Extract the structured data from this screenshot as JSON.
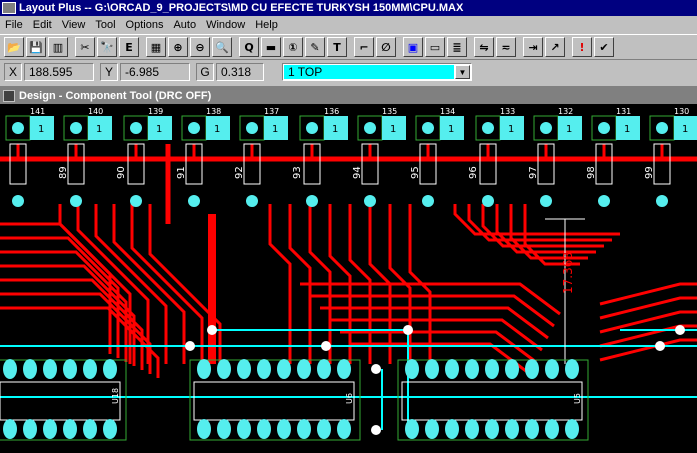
{
  "window": {
    "title": "Layout Plus -- G:\\ORCAD_9_PROJECTS\\MD CU EFECTE TURKYSH 150MM\\CPU.MAX"
  },
  "menu": [
    "File",
    "Edit",
    "View",
    "Tool",
    "Options",
    "Auto",
    "Window",
    "Help"
  ],
  "toolbar": {
    "buttons": [
      {
        "name": "open-icon",
        "glyph": "📂"
      },
      {
        "name": "save-icon",
        "glyph": "💾"
      },
      {
        "name": "report-icon",
        "glyph": "▥"
      },
      {
        "name": "cut-icon",
        "glyph": "✂"
      },
      {
        "name": "find-icon",
        "glyph": "🔭"
      },
      {
        "name": "spreadsheet-icon",
        "glyph": "E"
      },
      {
        "name": "grid-icon",
        "glyph": "▦"
      },
      {
        "name": "zoom-in-icon",
        "glyph": "⊕"
      },
      {
        "name": "zoom-out-icon",
        "glyph": "⊖"
      },
      {
        "name": "zoom-all-icon",
        "glyph": "🔍"
      },
      {
        "name": "query-icon",
        "glyph": "Q"
      },
      {
        "name": "component-icon",
        "glyph": "▬"
      },
      {
        "name": "pin-icon",
        "glyph": "①"
      },
      {
        "name": "edit-obstacle-icon",
        "glyph": "✎"
      },
      {
        "name": "text-icon",
        "glyph": "T"
      },
      {
        "name": "connection-icon",
        "glyph": "⌐"
      },
      {
        "name": "error-icon",
        "glyph": "∅"
      },
      {
        "name": "color-icon",
        "glyph": "▣"
      },
      {
        "name": "drc-box-icon",
        "glyph": "▭"
      },
      {
        "name": "layer-icon",
        "glyph": "≣"
      },
      {
        "name": "route-icon",
        "glyph": "⇋"
      },
      {
        "name": "shove-icon",
        "glyph": "≂"
      },
      {
        "name": "reconnect-icon",
        "glyph": "⇥"
      },
      {
        "name": "auto-path-icon",
        "glyph": "↗"
      },
      {
        "name": "online-drc-icon",
        "glyph": "!"
      },
      {
        "name": "drc-check-icon",
        "glyph": "✔"
      }
    ]
  },
  "coords": {
    "x_label": "X",
    "x_value": "188.595",
    "y_label": "Y",
    "y_value": "-6.985",
    "g_label": "G",
    "g_value": "0.318"
  },
  "layer": {
    "selected": "1 TOP"
  },
  "child_window": {
    "title": "Design - Component Tool (DRC OFF)"
  },
  "board": {
    "top_labels": [
      "141",
      "140",
      "139",
      "138",
      "137",
      "136",
      "135",
      "134",
      "133",
      "132",
      "131",
      "130"
    ],
    "pad_one_label": "1",
    "net_numbers": [
      "89",
      "90",
      "91",
      "92",
      "93",
      "94",
      "95",
      "96",
      "97",
      "98",
      "99"
    ],
    "dimension_label": "17.368",
    "ic_labels": [
      "U18",
      "U6",
      "U5"
    ],
    "colors": {
      "trace_red": "#ff0000",
      "trace_cyan": "#00ffff",
      "pad_cyan": "#55eeee",
      "outline_white": "#ffffff",
      "outline_green": "#33aa33"
    }
  }
}
